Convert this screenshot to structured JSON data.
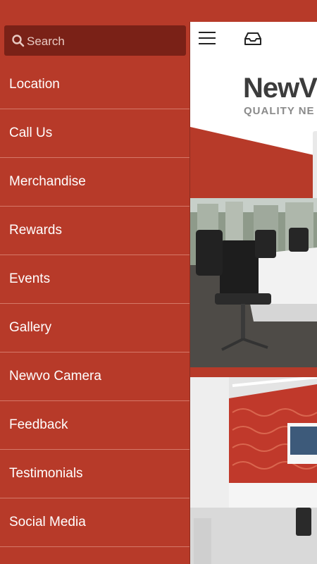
{
  "drawer": {
    "search": {
      "placeholder": "Search",
      "icon": "search-icon"
    },
    "items": [
      {
        "label": "Location"
      },
      {
        "label": "Call Us"
      },
      {
        "label": "Merchandise"
      },
      {
        "label": "Rewards"
      },
      {
        "label": "Events"
      },
      {
        "label": "Gallery"
      },
      {
        "label": "Newvo Camera"
      },
      {
        "label": "Feedback"
      },
      {
        "label": "Testimonials"
      },
      {
        "label": "Social Media"
      }
    ]
  },
  "content": {
    "logo": {
      "word": "NewV",
      "tagline": "QUALITY NE"
    },
    "icons": [
      "hamburger-icon",
      "inbox-icon"
    ]
  },
  "colors": {
    "drawer": "#b73a29",
    "search_bg": "#7a2117",
    "divider": "#d57868"
  }
}
